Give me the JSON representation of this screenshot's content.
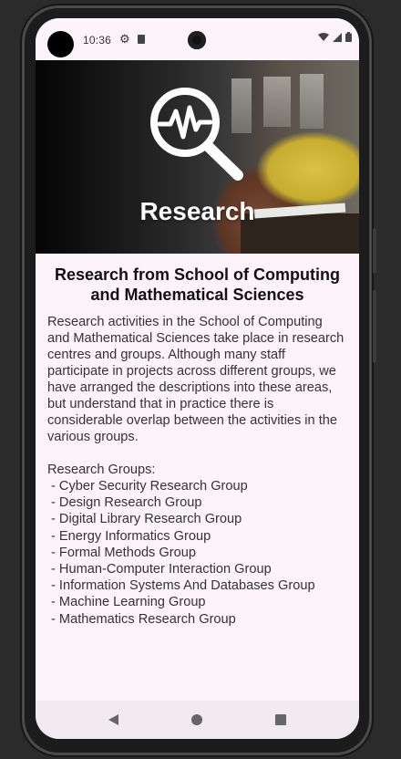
{
  "status_bar": {
    "time": "10:36",
    "icons": [
      "gear-icon",
      "sim-card-icon",
      "wifi-icon",
      "signal-icon",
      "battery-icon"
    ]
  },
  "hero": {
    "title": "Research",
    "icon": "research-magnifier-pulse-icon"
  },
  "page": {
    "title": "Research from School of Computing and Mathematical Sciences",
    "intro": "Research activities in the School of Computing and Mathematical Sciences take place in research centres and groups. Although many staff participate in projects across different groups, we have arranged the descriptions into these areas, but understand that in practice there is considerable overlap between the activities in the various groups.",
    "groups_heading": "Research Groups:",
    "groups": [
      "Cyber Security Research Group",
      "Design Research Group",
      "Digital Library Research Group",
      "Energy Informatics Group",
      "Formal Methods Group",
      "Human-Computer Interaction Group",
      "Information Systems And Databases Group",
      "Machine Learning Group",
      "Mathematics Research Group"
    ]
  },
  "nav_bar": {
    "buttons": [
      "back-icon",
      "home-icon",
      "recents-icon"
    ]
  },
  "colors": {
    "screen_background": "#fdf3fb",
    "text": "#333333"
  }
}
